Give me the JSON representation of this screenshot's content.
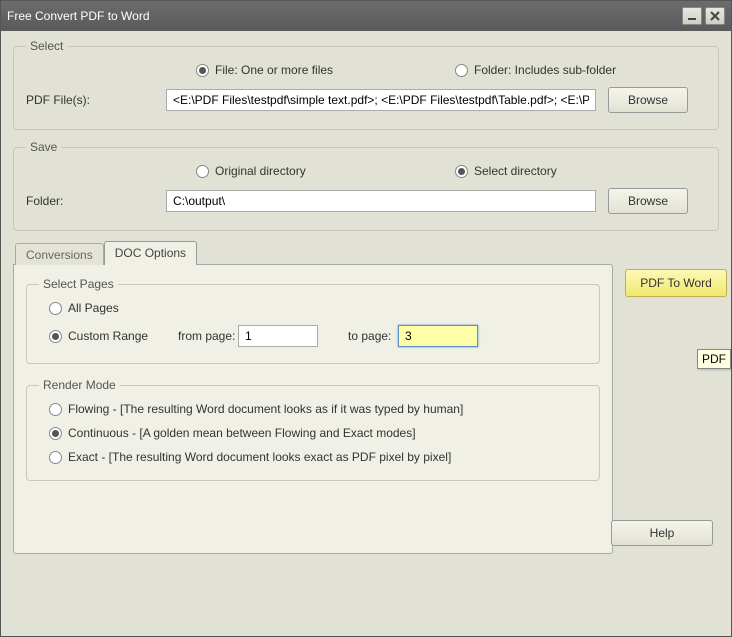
{
  "window": {
    "title": "Free Convert PDF to Word"
  },
  "select": {
    "legend": "Select",
    "file_radio": "File:  One or more files",
    "folder_radio": "Folder: Includes sub-folder",
    "file_label": "PDF File(s):",
    "file_value": "<E:\\PDF Files\\testpdf\\simple text.pdf>; <E:\\PDF Files\\testpdf\\Table.pdf>; <E:\\PDF",
    "browse": "Browse"
  },
  "save": {
    "legend": "Save",
    "original": "Original directory",
    "selectdir": "Select directory",
    "folder_label": "Folder:",
    "folder_value": "C:\\output\\",
    "browse": "Browse"
  },
  "tabs": {
    "conversions": "Conversions",
    "doc_options": "DOC Options"
  },
  "pages": {
    "legend": "Select Pages",
    "all": "All Pages",
    "custom": "Custom Range",
    "from_label": "from page:",
    "from_value": "1",
    "to_label": "to page:",
    "to_value": "3"
  },
  "render": {
    "legend": "Render Mode",
    "flowing": "Flowing - [The resulting Word document looks as if it was typed by human]",
    "continuous": "Continuous - [A golden mean between Flowing and Exact modes]",
    "exact": "Exact - [The resulting Word document looks exact as PDF pixel by pixel]"
  },
  "buttons": {
    "convert": "PDF To Word",
    "help": "Help"
  },
  "tooltip": "PDF"
}
